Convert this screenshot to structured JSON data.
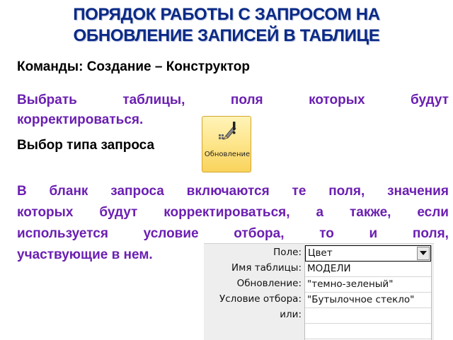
{
  "slide": {
    "title_line1": "ПОРЯДОК РАБОТЫ С ЗАПРОСОМ НА",
    "title_line2": "ОБНОВЛЕНИЕ ЗАПИСЕЙ В ТАБЛИЦЕ",
    "commands": "Команды: Создание – Конструктор",
    "select_tables_words": [
      "Выбрать",
      "таблицы,",
      "поля",
      "которых",
      "будут"
    ],
    "select_tables_line2": "корректироваться.",
    "query_type": "Выбор типа запроса",
    "include_fields_lines": [
      [
        "В",
        "бланк",
        "запроса",
        "включаются",
        "те",
        "поля,",
        "значения"
      ],
      [
        "которых",
        "будут",
        "корректироваться,",
        "а",
        "также,",
        "если"
      ],
      [
        "используется",
        "условие",
        "отбора,",
        "то",
        "и",
        "поля,"
      ]
    ],
    "include_fields_last": "участвующие в нем."
  },
  "update_button": {
    "label": "Обновление",
    "icon": "pencil-exclamation-icon"
  },
  "query_grid": {
    "labels": [
      "Поле:",
      "Имя таблицы:",
      "Обновление:",
      "Условие отбора:",
      "или:"
    ],
    "field_value": "Цвет",
    "table_value": "МОДЕЛИ",
    "update_value": "\"темно-зеленый\"",
    "criteria_value": "\"Бутылочное стекло\"",
    "or_value": ""
  },
  "colors": {
    "title": "#0b2a86",
    "accent_text": "#6b1fb1",
    "button_bg": "#fde58a"
  }
}
